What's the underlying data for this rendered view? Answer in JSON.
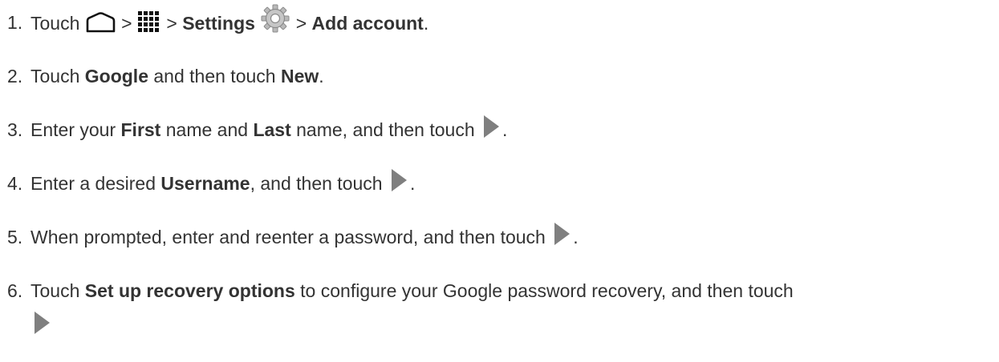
{
  "steps": [
    {
      "number": "1.",
      "parts": {
        "a": "Touch",
        "sep1": ">",
        "sep2": ">",
        "settings": "Settings",
        "sep3": ">",
        "add_account": "Add account",
        "end": "."
      },
      "icons": [
        "home-icon",
        "apps-grid-icon",
        "settings-gear-icon"
      ]
    },
    {
      "number": "2.",
      "parts": {
        "a": "Touch",
        "google": "Google",
        "b": "and then touch",
        "new": "New",
        "end": "."
      }
    },
    {
      "number": "3.",
      "parts": {
        "a": "Enter your",
        "first": "First",
        "b": "name and",
        "last": "Last",
        "c": "name, and then touch",
        "end": "."
      },
      "icons": [
        "next-arrow-icon"
      ]
    },
    {
      "number": "4.",
      "parts": {
        "a": "Enter a desired",
        "username": "Username",
        "b": ", and then touch",
        "end": "."
      },
      "icons": [
        "next-arrow-icon"
      ]
    },
    {
      "number": "5.",
      "parts": {
        "a": "When prompted, enter and reenter a password, and then touch",
        "end": "."
      },
      "icons": [
        "next-arrow-icon"
      ]
    },
    {
      "number": "6.",
      "parts": {
        "a": "Touch",
        "recovery": "Set up recovery options",
        "b": "to configure your Google password recovery, and then touch"
      },
      "icons": [
        "next-arrow-icon"
      ]
    }
  ],
  "colors": {
    "text": "#333333",
    "icon_gray": "#8a8a8a",
    "arrow_gray": "#7f7f7f"
  }
}
